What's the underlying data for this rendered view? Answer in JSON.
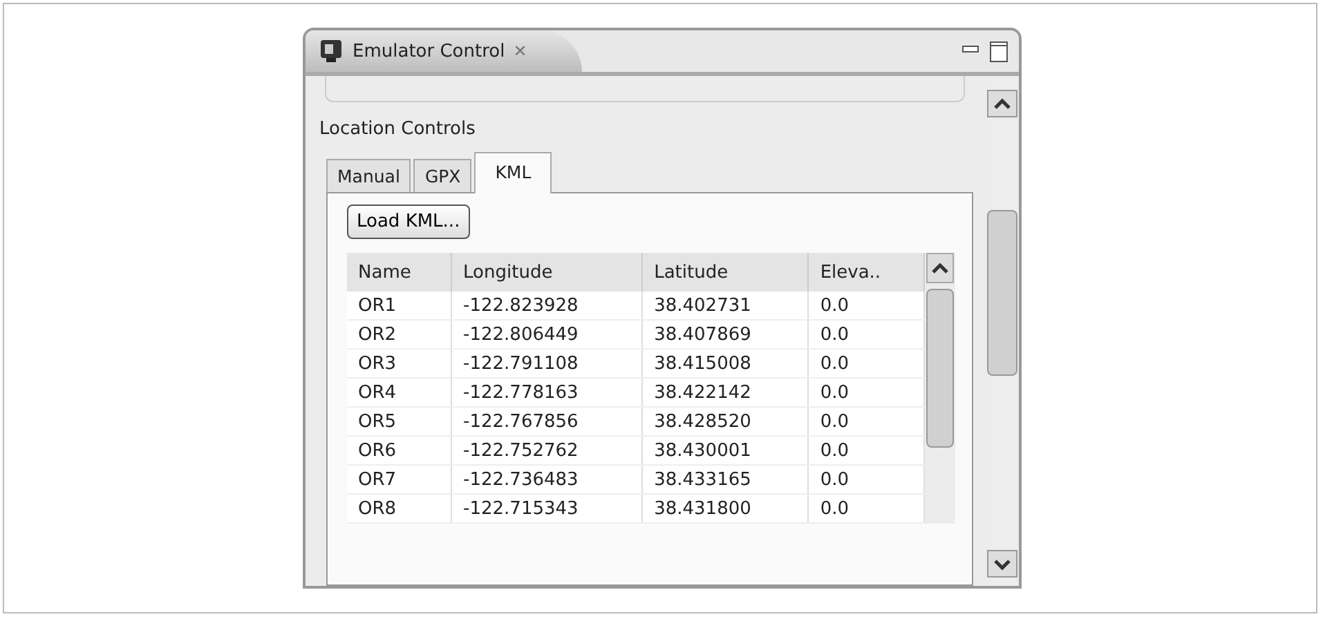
{
  "view": {
    "title": "Emulator Control",
    "close": "✕"
  },
  "section": {
    "title": "Location Controls"
  },
  "tabs": [
    {
      "label": "Manual",
      "selected": false
    },
    {
      "label": "GPX",
      "selected": false
    },
    {
      "label": "KML",
      "selected": true
    }
  ],
  "load_button": "Load KML...",
  "table": {
    "columns": [
      "Name",
      "Longitude",
      "Latitude",
      "Eleva.."
    ],
    "rows": [
      [
        "OR1",
        "-122.823928",
        "38.402731",
        "0.0"
      ],
      [
        "OR2",
        "-122.806449",
        "38.407869",
        "0.0"
      ],
      [
        "OR3",
        "-122.791108",
        "38.415008",
        "0.0"
      ],
      [
        "OR4",
        "-122.778163",
        "38.422142",
        "0.0"
      ],
      [
        "OR5",
        "-122.767856",
        "38.428520",
        "0.0"
      ],
      [
        "OR6",
        "-122.752762",
        "38.430001",
        "0.0"
      ],
      [
        "OR7",
        "-122.736483",
        "38.433165",
        "0.0"
      ],
      [
        "OR8",
        "-122.715343",
        "38.431800",
        "0.0"
      ]
    ]
  }
}
